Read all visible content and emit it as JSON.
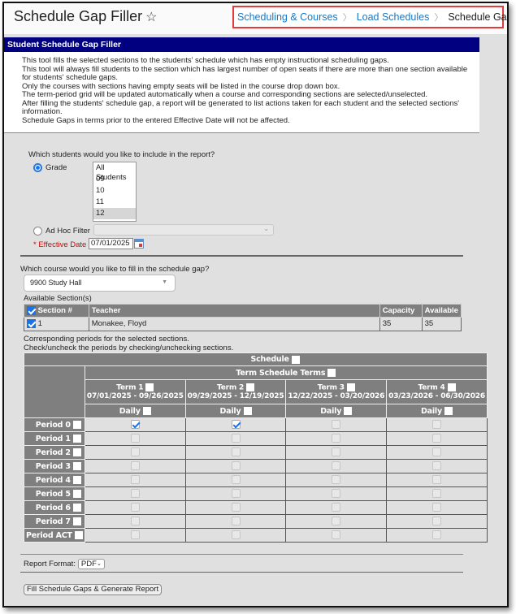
{
  "header": {
    "title": "Schedule Gap Filler",
    "breadcrumb": [
      "Scheduling & Courses",
      "Load Schedules",
      "Schedule Gap Filler"
    ]
  },
  "panel": {
    "title": "Student Schedule Gap Filler",
    "lines": [
      "This tool fills the selected sections to the students' schedule which has empty instructional scheduling gaps.",
      "This tool will always fill students to the section which has largest number of open seats if there are more than one section available for students' schedule gaps.",
      "Only the courses with sections having empty seats will be listed in the course drop down box.",
      "The term-period grid will be updated automatically when a course and corresponding sections are selected/unselected.",
      "After filling the students' schedule gap, a report will be generated to list actions taken for each student and the selected sections' information.",
      "Schedule Gaps in terms prior to the entered Effective Date will not be affected."
    ]
  },
  "students": {
    "question": "Which students would you like to include in the report?",
    "grade_label": "Grade",
    "grade_selected": true,
    "grades": [
      "All Students",
      "09",
      "10",
      "11",
      "12"
    ],
    "selected_grade": "12",
    "adhoc_label": "Ad Hoc Filter",
    "adhoc_value": "",
    "effective_date_label": "* Effective Date",
    "effective_date": "07/01/2025"
  },
  "course": {
    "question": "Which course would you like to fill in the schedule gap?",
    "selected": "9900 Study Hall",
    "available_label": "Available Section(s)",
    "columns": [
      "Section #",
      "Teacher",
      "Capacity",
      "Available"
    ],
    "rows": [
      {
        "section": "1",
        "teacher": "Monakee, Floyd",
        "capacity": "35",
        "available": "35",
        "checked": true
      }
    ]
  },
  "periods_note": [
    "Corresponding periods for the selected sections.",
    "Check/uncheck the periods by checking/unchecking sections."
  ],
  "grid": {
    "schedule_label": "Schedule",
    "term_schedule_label": "Term Schedule Terms",
    "terms": [
      {
        "name": "Term 1",
        "dates": "07/01/2025 - 09/26/2025",
        "day": "Daily"
      },
      {
        "name": "Term 2",
        "dates": "09/29/2025 - 12/19/2025",
        "day": "Daily"
      },
      {
        "name": "Term 3",
        "dates": "12/22/2025 - 03/20/2026",
        "day": "Daily"
      },
      {
        "name": "Term 4",
        "dates": "03/23/2026 - 06/30/2026",
        "day": "Daily"
      }
    ],
    "periods": [
      {
        "name": "Period 0",
        "checks": [
          true,
          true,
          false,
          false
        ],
        "enabled": true
      },
      {
        "name": "Period 1",
        "checks": [
          false,
          false,
          false,
          false
        ],
        "enabled": false
      },
      {
        "name": "Period 2",
        "checks": [
          false,
          false,
          false,
          false
        ],
        "enabled": false
      },
      {
        "name": "Period 3",
        "checks": [
          false,
          false,
          false,
          false
        ],
        "enabled": false
      },
      {
        "name": "Period 4",
        "checks": [
          false,
          false,
          false,
          false
        ],
        "enabled": false
      },
      {
        "name": "Period 5",
        "checks": [
          false,
          false,
          false,
          false
        ],
        "enabled": false
      },
      {
        "name": "Period 6",
        "checks": [
          false,
          false,
          false,
          false
        ],
        "enabled": false
      },
      {
        "name": "Period 7",
        "checks": [
          false,
          false,
          false,
          false
        ],
        "enabled": false
      },
      {
        "name": "Period ACT",
        "checks": [
          false,
          false,
          false,
          false
        ],
        "enabled": false
      }
    ]
  },
  "report": {
    "format_label": "Report Format:",
    "format_value": "PDF",
    "generate_button": "Fill Schedule Gaps & Generate Report"
  }
}
